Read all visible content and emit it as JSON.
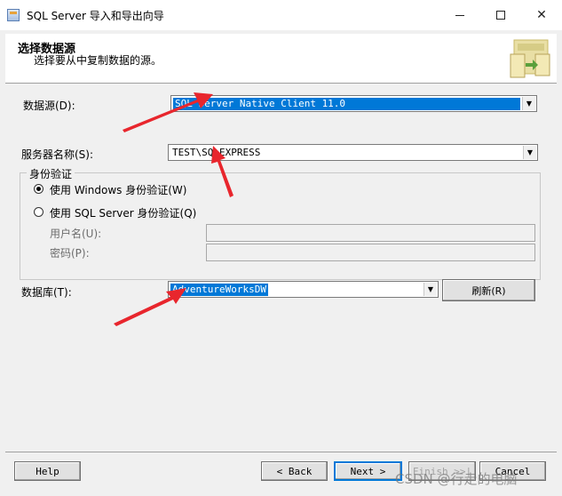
{
  "window": {
    "title": "SQL Server 导入和导出向导",
    "minimize_glyph": "",
    "close_glyph": "✕"
  },
  "header": {
    "title": "选择数据源",
    "subtitle": "选择要从中复制数据的源。"
  },
  "form": {
    "datasource_label": "数据源(D):",
    "datasource_value": "SQL Server Native Client 11.0",
    "server_label": "服务器名称(S):",
    "server_value": "TEST\\SQLEXPRESS",
    "auth_group_label": "身份验证",
    "auth_windows_label": "使用 Windows 身份验证(W)",
    "auth_sql_label": "使用 SQL Server 身份验证(Q)",
    "username_label": "用户名(U):",
    "password_label": "密码(P):",
    "database_label": "数据库(T):",
    "database_value": "AdventureWorksDW",
    "refresh_label": "刷新(R)"
  },
  "footer": {
    "help_label": "Help",
    "back_label": "< Back",
    "next_label": "Next >",
    "finish_label": "Finish >>|",
    "cancel_label": "Cancel"
  },
  "watermark": "CSDN @行走的电脑",
  "colors": {
    "selection": "#0078d7",
    "annotation_arrow": "#e8262d"
  }
}
